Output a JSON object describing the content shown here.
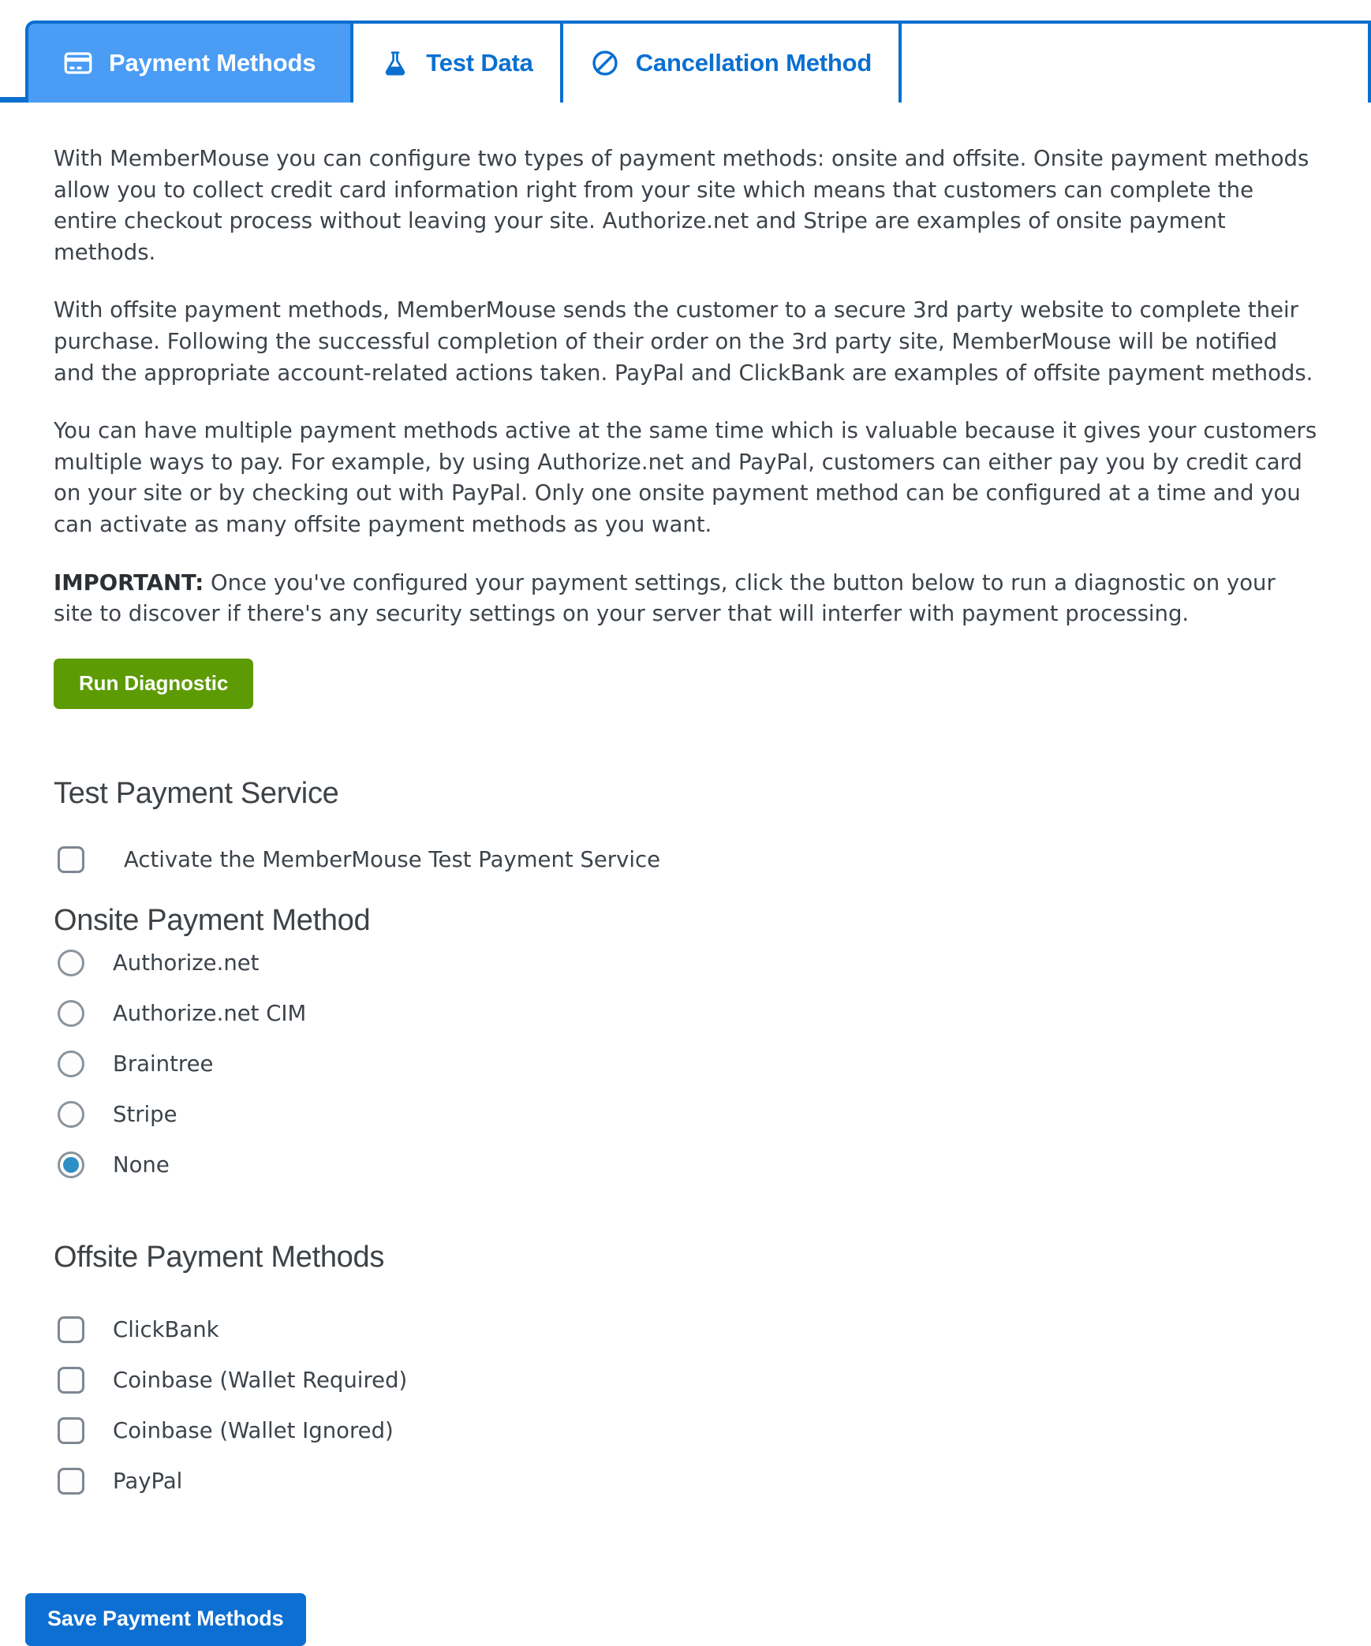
{
  "colors": {
    "tab_active_bg": "#4a9cf5",
    "tab_border": "#0b6fd0",
    "tab_text": "#0b6fd0",
    "diagnostic_button_bg": "#5d9b05",
    "save_button_bg": "#0d6fd1",
    "radio_selected_dot": "#2d8fc4",
    "body_text": "#3c434a"
  },
  "tabs": [
    {
      "label": "Payment Methods",
      "icon": "credit-card-icon",
      "active": true
    },
    {
      "label": "Test Data",
      "icon": "flask-icon",
      "active": false
    },
    {
      "label": "Cancellation Method",
      "icon": "ban-icon",
      "active": false
    }
  ],
  "intro": {
    "paragraph_1": "With MemberMouse you can configure two types of payment methods: onsite and offsite. Onsite payment methods allow you to collect credit card information right from your site which means that customers can complete the entire checkout process without leaving your site. Authorize.net and Stripe are examples of onsite payment methods.",
    "paragraph_2": "With offsite payment methods, MemberMouse sends the customer to a secure 3rd party website to complete their purchase. Following the successful completion of their order on the 3rd party site, MemberMouse will be notified and the appropriate account-related actions taken. PayPal and ClickBank are examples of offsite payment methods.",
    "paragraph_3": "You can have multiple payment methods active at the same time which is valuable because it gives your customers multiple ways to pay. For example, by using Authorize.net and PayPal, customers can either pay you by credit card on your site or by checking out with PayPal. Only one onsite payment method can be configured at a time and you can activate as many offsite payment methods as you want.",
    "important_label": "IMPORTANT:",
    "important_text": " Once you've configured your payment settings, click the button below to run a diagnostic on your site to discover if there's any security settings on your server that will interfer with payment processing."
  },
  "diagnostic_button": {
    "label": "Run Diagnostic"
  },
  "test_payment_service": {
    "heading": "Test Payment Service",
    "checkbox_label": "Activate the MemberMouse Test Payment Service",
    "checked": false
  },
  "onsite": {
    "heading": "Onsite Payment Method",
    "options": [
      {
        "label": "Authorize.net",
        "selected": false
      },
      {
        "label": "Authorize.net CIM",
        "selected": false
      },
      {
        "label": "Braintree",
        "selected": false
      },
      {
        "label": "Stripe",
        "selected": false
      },
      {
        "label": "None",
        "selected": true
      }
    ]
  },
  "offsite": {
    "heading": "Offsite Payment Methods",
    "options": [
      {
        "label": "ClickBank",
        "checked": false
      },
      {
        "label": "Coinbase (Wallet Required)",
        "checked": false
      },
      {
        "label": "Coinbase (Wallet Ignored)",
        "checked": false
      },
      {
        "label": "PayPal",
        "checked": false
      }
    ]
  },
  "save_button": {
    "label": "Save Payment Methods"
  }
}
